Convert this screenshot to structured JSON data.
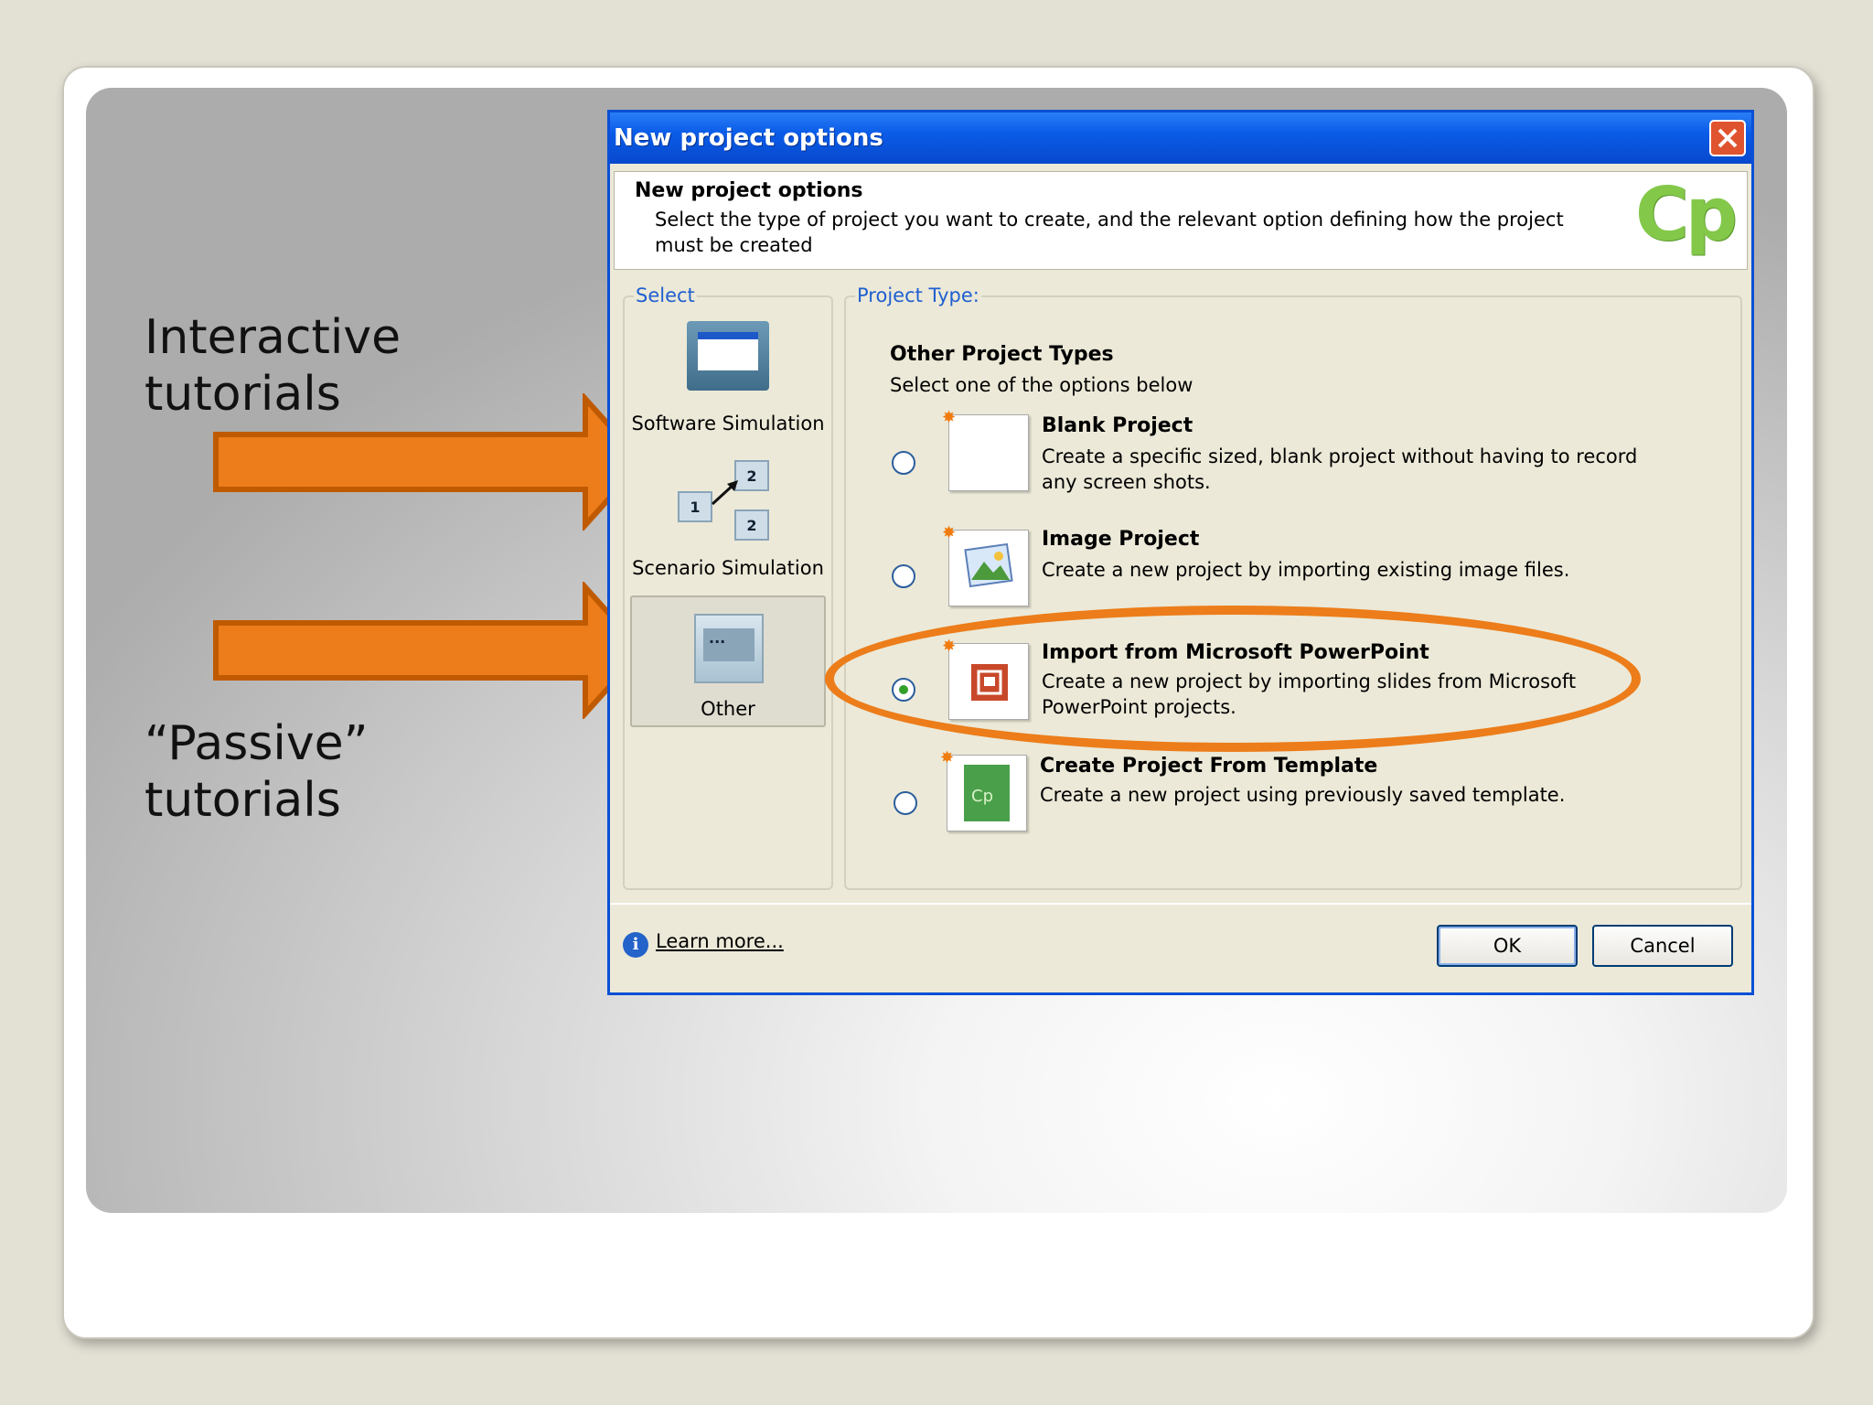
{
  "slide": {
    "label_interactive": "Interactive\ntutorials",
    "label_passive": "“Passive”\ntutorials",
    "arrow_color": "#ec7d1a"
  },
  "dialog": {
    "title": "New project options",
    "header_title": "New project options",
    "header_desc": "Select the type of project you want to create, and the relevant option defining how the project must be created",
    "logo_text": "Cp",
    "select_group": {
      "legend": "Select",
      "items": [
        {
          "label": "Software Simulation",
          "icon": "monitor-icon"
        },
        {
          "label": "Scenario Simulation",
          "icon": "scenario-icon"
        },
        {
          "label": "Other",
          "icon": "other-icon",
          "selected": true
        }
      ]
    },
    "project_group": {
      "legend": "Project Type:",
      "heading": "Other Project Types",
      "subheading": "Select one of the options below",
      "options": [
        {
          "title": "Blank Project",
          "desc": "Create a specific sized, blank project without having to record any screen shots.",
          "checked": false
        },
        {
          "title": "Image Project",
          "desc": "Create a new project by importing existing image files.",
          "checked": false
        },
        {
          "title": "Import from Microsoft PowerPoint",
          "desc": "Create a new project by importing slides from Microsoft PowerPoint projects.",
          "checked": true
        },
        {
          "title": "Create Project From Template",
          "desc": "Create a new project using previously saved template.",
          "checked": false
        }
      ]
    },
    "footer": {
      "learn_more": "Learn more...",
      "ok": "OK",
      "cancel": "Cancel"
    }
  }
}
